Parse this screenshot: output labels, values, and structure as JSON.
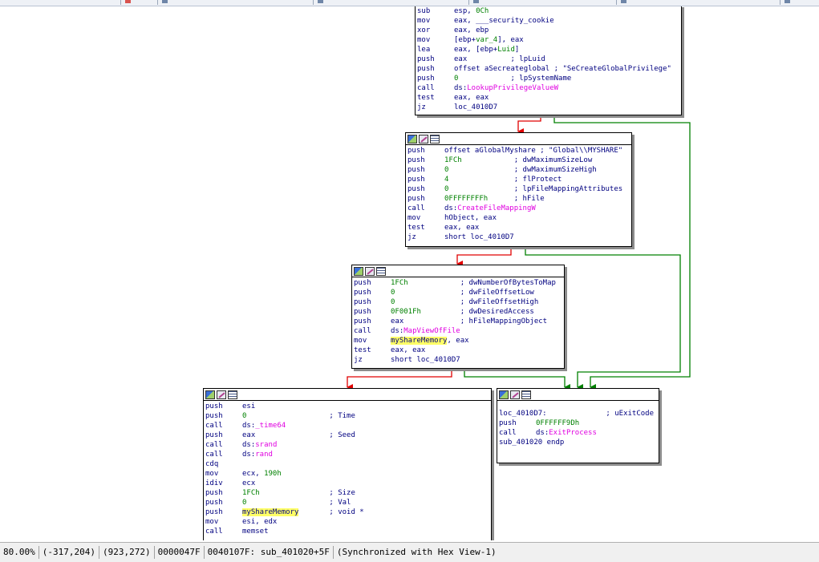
{
  "nodes": {
    "n1": {
      "rows": [
        {
          "mn": "sub",
          "op": [
            {
              "t": "esp, "
            },
            {
              "t": "0Ch",
              "c": "g"
            }
          ],
          "cm": ""
        },
        {
          "mn": "mov",
          "op": [
            {
              "t": "eax, ___security_cookie"
            }
          ],
          "cm": ""
        },
        {
          "mn": "xor",
          "op": [
            {
              "t": "eax, ebp"
            }
          ],
          "cm": ""
        },
        {
          "mn": "mov",
          "op": [
            {
              "t": "[ebp+"
            },
            {
              "t": "var_4",
              "c": "g"
            },
            {
              "t": "], eax"
            }
          ],
          "cm": ""
        },
        {
          "mn": "lea",
          "op": [
            {
              "t": "eax, [ebp+"
            },
            {
              "t": "Luid",
              "c": "g"
            },
            {
              "t": "]"
            }
          ],
          "cm": ""
        },
        {
          "mn": "push",
          "op": [
            {
              "t": "eax"
            }
          ],
          "cm": "          ; lpLuid"
        },
        {
          "mn": "push",
          "op": [
            {
              "t": "offset aSecreateglobal"
            }
          ],
          "cm": " ; \"SeCreateGlobalPrivilege\"",
          "cmc": "gr"
        },
        {
          "mn": "push",
          "op": [
            {
              "t": "0",
              "c": "g"
            }
          ],
          "cm": "            ; lpSystemName"
        },
        {
          "mn": "call",
          "op": [
            {
              "t": "ds:"
            },
            {
              "t": "LookupPrivilegeValueW",
              "c": "p"
            }
          ],
          "cm": ""
        },
        {
          "mn": "test",
          "op": [
            {
              "t": "eax, eax"
            }
          ],
          "cm": ""
        },
        {
          "mn": "jz",
          "op": [
            {
              "t": "loc_4010D7"
            }
          ],
          "cm": ""
        }
      ]
    },
    "n2": {
      "rows": [
        {
          "mn": "push",
          "op": [
            {
              "t": "offset aGlobalMyshare"
            }
          ],
          "cm": " ; \"Global\\\\MYSHARE\"",
          "cmc": "gr"
        },
        {
          "mn": "push",
          "op": [
            {
              "t": "1FCh",
              "c": "g"
            }
          ],
          "cm": "            ; dwMaximumSizeLow"
        },
        {
          "mn": "push",
          "op": [
            {
              "t": "0",
              "c": "g"
            }
          ],
          "cm": "               ; dwMaximumSizeHigh"
        },
        {
          "mn": "push",
          "op": [
            {
              "t": "4",
              "c": "g"
            }
          ],
          "cm": "               ; flProtect"
        },
        {
          "mn": "push",
          "op": [
            {
              "t": "0",
              "c": "g"
            }
          ],
          "cm": "               ; lpFileMappingAttributes"
        },
        {
          "mn": "push",
          "op": [
            {
              "t": "0FFFFFFFFh",
              "c": "g"
            }
          ],
          "cm": "      ; hFile"
        },
        {
          "mn": "call",
          "op": [
            {
              "t": "ds:"
            },
            {
              "t": "CreateFileMappingW",
              "c": "p"
            }
          ],
          "cm": ""
        },
        {
          "mn": "mov",
          "op": [
            {
              "t": "hObject, eax"
            }
          ],
          "cm": ""
        },
        {
          "mn": "test",
          "op": [
            {
              "t": "eax, eax"
            }
          ],
          "cm": ""
        },
        {
          "mn": "jz",
          "op": [
            {
              "t": "short loc_4010D7"
            }
          ],
          "cm": ""
        }
      ]
    },
    "n3": {
      "rows": [
        {
          "mn": "push",
          "op": [
            {
              "t": "1FCh",
              "c": "g"
            }
          ],
          "cm": "            ; dwNumberOfBytesToMap"
        },
        {
          "mn": "push",
          "op": [
            {
              "t": "0",
              "c": "g"
            }
          ],
          "cm": "               ; dwFileOffsetLow"
        },
        {
          "mn": "push",
          "op": [
            {
              "t": "0",
              "c": "g"
            }
          ],
          "cm": "               ; dwFileOffsetHigh"
        },
        {
          "mn": "push",
          "op": [
            {
              "t": "0F001Fh",
              "c": "g"
            }
          ],
          "cm": "         ; dwDesiredAccess"
        },
        {
          "mn": "push",
          "op": [
            {
              "t": "eax"
            }
          ],
          "cm": "             ; hFileMappingObject"
        },
        {
          "mn": "call",
          "op": [
            {
              "t": "ds:"
            },
            {
              "t": "MapViewOfFile",
              "c": "p"
            }
          ],
          "cm": ""
        },
        {
          "mn": "mov",
          "op": [
            {
              "t": "myShareMemory",
              "c": "hl"
            },
            {
              "t": ", eax"
            }
          ],
          "cm": ""
        },
        {
          "mn": "test",
          "op": [
            {
              "t": "eax, eax"
            }
          ],
          "cm": ""
        },
        {
          "mn": "jz",
          "op": [
            {
              "t": "short loc_4010D7"
            }
          ],
          "cm": ""
        }
      ]
    },
    "n4": {
      "rows": [
        {
          "mn": "push",
          "op": [
            {
              "t": "esi"
            }
          ],
          "cm": ""
        },
        {
          "mn": "push",
          "op": [
            {
              "t": "0",
              "c": "g"
            }
          ],
          "cm": "                   ; Time"
        },
        {
          "mn": "call",
          "op": [
            {
              "t": "ds:"
            },
            {
              "t": "_time64",
              "c": "p"
            }
          ],
          "cm": ""
        },
        {
          "mn": "push",
          "op": [
            {
              "t": "eax"
            }
          ],
          "cm": "                 ; Seed"
        },
        {
          "mn": "call",
          "op": [
            {
              "t": "ds:"
            },
            {
              "t": "srand",
              "c": "p"
            }
          ],
          "cm": ""
        },
        {
          "mn": "call",
          "op": [
            {
              "t": "ds:"
            },
            {
              "t": "rand",
              "c": "p"
            }
          ],
          "cm": ""
        },
        {
          "mn": "cdq",
          "op": [],
          "cm": ""
        },
        {
          "mn": "mov",
          "op": [
            {
              "t": "ecx, "
            },
            {
              "t": "190h",
              "c": "g"
            }
          ],
          "cm": ""
        },
        {
          "mn": "idiv",
          "op": [
            {
              "t": "ecx"
            }
          ],
          "cm": ""
        },
        {
          "mn": "push",
          "op": [
            {
              "t": "1FCh",
              "c": "g"
            }
          ],
          "cm": "                ; Size"
        },
        {
          "mn": "push",
          "op": [
            {
              "t": "0",
              "c": "g"
            }
          ],
          "cm": "                   ; Val"
        },
        {
          "mn": "push",
          "op": [
            {
              "t": "myShareMemory",
              "c": "hl"
            }
          ],
          "cm": "       ; void *"
        },
        {
          "mn": "mov",
          "op": [
            {
              "t": "esi, edx"
            }
          ],
          "cm": ""
        },
        {
          "mn": "call",
          "op": [
            {
              "t": "memset"
            }
          ],
          "cm": ""
        }
      ]
    },
    "n5": {
      "label": "loc_4010D7:",
      "label_comment": "; uExitCode",
      "rows": [
        {
          "mn": "push",
          "op": [
            {
              "t": "0FFFFFF9Dh",
              "c": "g"
            }
          ],
          "cm": ""
        },
        {
          "mn": "call",
          "op": [
            {
              "t": "ds:"
            },
            {
              "t": "ExitProcess",
              "c": "p"
            }
          ],
          "cm": ""
        }
      ],
      "footer": "sub_401020 endp"
    }
  },
  "status": {
    "zoom": "80.00%",
    "mouse_pos": "(-317,204)",
    "graph_pos": "(923,272)",
    "file_offset": "0000047F",
    "address": "0040107F: sub_401020+5F",
    "sync": "(Synchronized with Hex View-1)"
  },
  "colors": {
    "edge_true": "#008000",
    "edge_false": "#e00000",
    "highlight": "#ffff66"
  }
}
